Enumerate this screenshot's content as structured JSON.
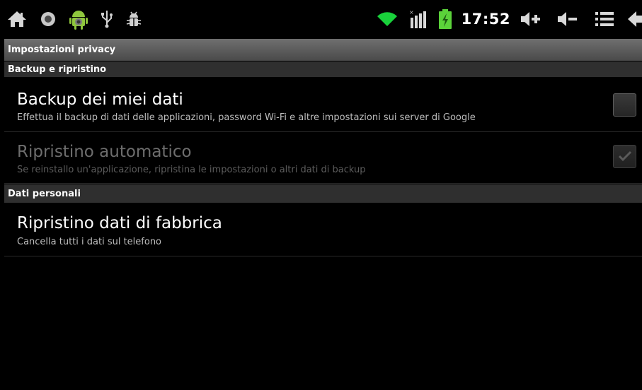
{
  "status_bar": {
    "clock": "17:52",
    "left_icons": [
      "home-icon",
      "record-icon",
      "android-icon",
      "usb-icon",
      "debug-icon"
    ],
    "right_icons": [
      "wifi-icon",
      "signal-icon",
      "battery-charging-icon",
      "volume-up-icon",
      "volume-down-icon",
      "menu-icon",
      "back-icon"
    ],
    "accent_color": "#33b5e5",
    "wifi_color": "#19d13b"
  },
  "screen": {
    "title": "Impostazioni privacy"
  },
  "sections": {
    "backup": {
      "header": "Backup e ripristino",
      "items": [
        {
          "title": "Backup dei miei dati",
          "summary": "Effettua il backup di dati delle applicazioni, password Wi-Fi e altre impostazioni sui server di Google",
          "checked": false,
          "enabled": true
        },
        {
          "title": "Ripristino automatico",
          "summary": "Se reinstallo un'applicazione, ripristina le impostazioni o altri dati di backup",
          "checked": true,
          "enabled": false
        }
      ]
    },
    "personal": {
      "header": "Dati personali",
      "items": [
        {
          "title": "Ripristino dati di fabbrica",
          "summary": "Cancella tutti i dati sul telefono"
        }
      ]
    }
  }
}
